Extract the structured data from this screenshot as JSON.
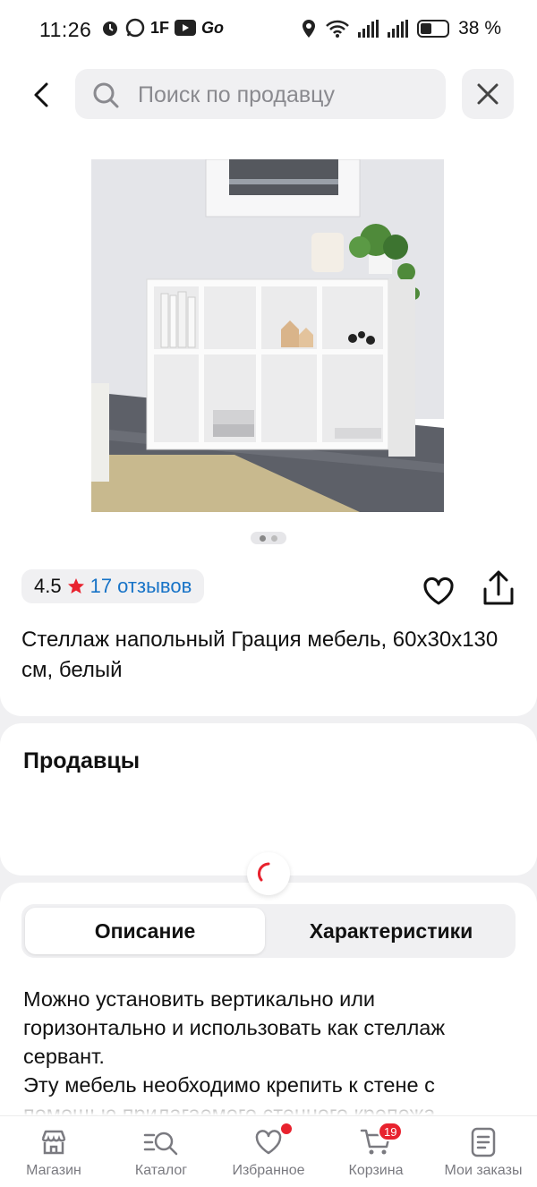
{
  "status_bar": {
    "time": "11:26",
    "left_icons": [
      "alarm-icon",
      "whatsapp-icon",
      "1F",
      "youtube-icon",
      "Go"
    ],
    "battery": "38 %"
  },
  "search": {
    "placeholder": "Поиск по продавцу"
  },
  "product": {
    "rating": "4.5",
    "reviews_label": "17 отзывов",
    "title": "Стеллаж напольный Грация мебель, 60х30х130 см, белый",
    "image_count": 2,
    "current_image": 1
  },
  "sellers": {
    "title": "Продавцы"
  },
  "tabs": {
    "description": "Описание",
    "specs": "Характеристики",
    "active": "description"
  },
  "description": {
    "paragraphs": [
      "Можно установить вертикально или горизонтально и использовать как стеллаж сервант.",
      "Эту мебель необходимо крепить к стене с помощью прилагаемого стенного крепежа"
    ]
  },
  "bottom_nav": {
    "items": [
      {
        "label": "Магазин",
        "icon": "store-icon"
      },
      {
        "label": "Каталог",
        "icon": "catalog-search-icon"
      },
      {
        "label": "Избранное",
        "icon": "heart-icon",
        "dot": true
      },
      {
        "label": "Корзина",
        "icon": "cart-icon",
        "badge": "19"
      },
      {
        "label": "Мои заказы",
        "icon": "orders-icon"
      }
    ]
  },
  "colors": {
    "accent_red": "#e8222e",
    "link_blue": "#1773c7",
    "background": "#f0f0f2"
  }
}
